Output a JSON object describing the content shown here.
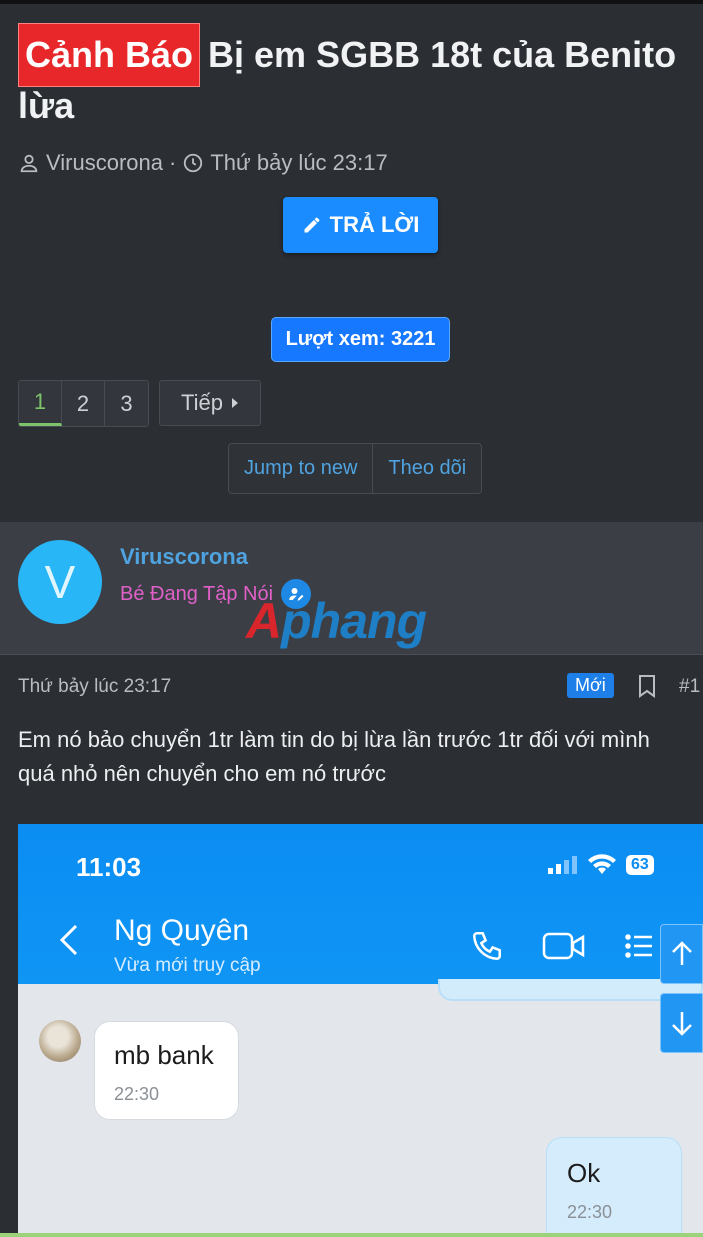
{
  "thread": {
    "prefix": "Cảnh Báo",
    "title_line1": "Bị em SGBB 18t của Benito",
    "title_line2": "lừa",
    "author": "Viruscorona",
    "separator": "·",
    "date": "Thứ bảy lúc 23:17"
  },
  "toolbar": {
    "reply_label": "TRẢ LỜI",
    "views_label": "Lượt xem: 3221"
  },
  "pagination": {
    "pages": [
      "1",
      "2",
      "3"
    ],
    "current": "1",
    "next_label": "Tiếp"
  },
  "actions": {
    "jump_label": "Jump to new",
    "follow_label": "Theo dõi"
  },
  "post": {
    "avatar_letter": "V",
    "username": "Viruscorona",
    "user_title": "Bé Đang Tập Nói",
    "watermark_a": "A",
    "watermark_b": "phang",
    "date": "Thứ bảy lúc 23:17",
    "new_badge": "Mới",
    "number": "#1",
    "body": "Em nó bảo chuyển 1tr làm tin do bị lừa lần trước 1tr đối với mình quá nhỏ nên chuyển cho em nó trước"
  },
  "screenshot": {
    "time": "11:03",
    "battery": "63",
    "contact_name": "Ng Quyên",
    "last_seen": "Vừa mới truy cập",
    "messages": [
      {
        "text": "mb bank",
        "time": "22:30"
      },
      {
        "text": "Ok",
        "time": "22:30"
      }
    ]
  },
  "colors": {
    "prefix_bg": "#e8272a",
    "primary_button": "#1b8cff",
    "link": "#4fa3e0",
    "user_title": "#e060c8",
    "messenger_blue": "#0b8df2"
  }
}
